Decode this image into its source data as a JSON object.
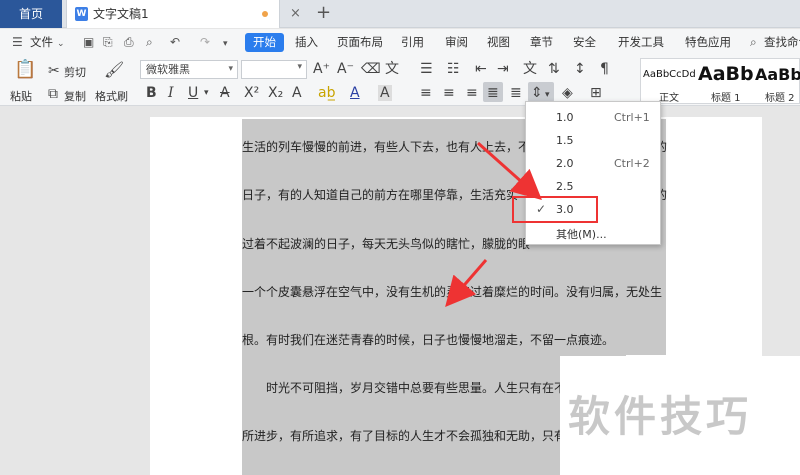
{
  "tabs": {
    "home": "首页",
    "document": "文字文稿1",
    "close": "×",
    "add": "+"
  },
  "menu": {
    "file": "文件",
    "items": [
      "开始",
      "插入",
      "页面布局",
      "引用",
      "审阅",
      "视图",
      "章节",
      "安全",
      "开发工具",
      "特色应用"
    ],
    "search": "查找命令"
  },
  "toolbar": {
    "paste": "粘贴",
    "cut": "剪切",
    "copy": "复制",
    "format_painter": "格式刷",
    "font_name": "微软雅黑",
    "font_size": "",
    "styles": [
      {
        "sample": "AaBbCcDd",
        "name": "正文"
      },
      {
        "sample": "AaBb",
        "name": "标题 1"
      },
      {
        "sample": "AaBb",
        "name": "标题 2"
      }
    ]
  },
  "line_spacing_menu": {
    "options": [
      {
        "label": "1.0",
        "shortcut": "Ctrl+1",
        "checked": false
      },
      {
        "label": "1.5",
        "shortcut": "",
        "checked": false
      },
      {
        "label": "2.0",
        "shortcut": "Ctrl+2",
        "checked": false
      },
      {
        "label": "2.5",
        "shortcut": "",
        "checked": false
      },
      {
        "label": "3.0",
        "shortcut": "",
        "checked": true
      },
      {
        "label": "其他(M)...",
        "shortcut": "",
        "checked": false
      }
    ]
  },
  "document": {
    "lines": [
      "生活的列车慢慢的前进，有些人下去，也有人上去，不",
      "日子，有的人知道自己的前方在哪里停靠，生活充实",
      "过着不起波澜的日子，每天无头鸟似的瞎忙，朦胧的眼",
      "一个个皮囊悬浮在空气中，没有生机的灵魂过着糜烂的时间。没有归属，无处生",
      "根。有时我们在迷茫青春的时候，日子也慢慢地溜走，不留一点痕迹。",
      "时光不可阻挡，岁月交错中总要有些思量。人生只有在不",
      "所进步，有所追求，有了目标的人生才不会孤独和无助，只有"
    ],
    "line_end_chars": [
      "的",
      "的"
    ]
  },
  "watermark": "软件技巧",
  "colors": {
    "accent": "#2b7ded",
    "home_tab": "#2b579a",
    "selection": "#c8c8c8",
    "highlight": "#e33333"
  }
}
